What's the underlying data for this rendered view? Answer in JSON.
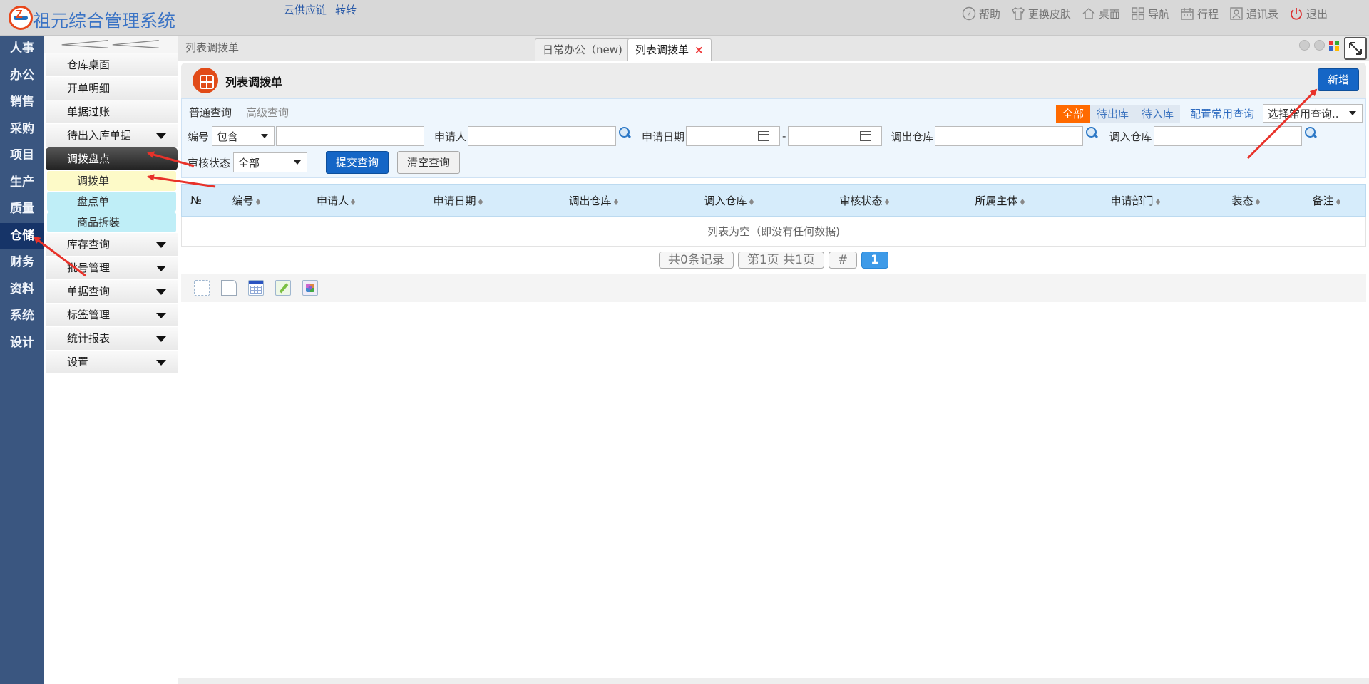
{
  "app": {
    "title": "祖元综合管理系统"
  },
  "header": {
    "links": [
      "云供应链",
      "转转"
    ],
    "actions": [
      {
        "label": "帮助",
        "icon": "help-icon"
      },
      {
        "label": "更换皮肤",
        "icon": "shirt-icon"
      },
      {
        "label": "桌面",
        "icon": "home-icon"
      },
      {
        "label": "导航",
        "icon": "nav-icon"
      },
      {
        "label": "行程",
        "icon": "calendar-icon"
      },
      {
        "label": "通讯录",
        "icon": "contacts-icon"
      },
      {
        "label": "退出",
        "icon": "power-icon"
      }
    ]
  },
  "leftnav": {
    "items": [
      "人事",
      "办公",
      "销售",
      "采购",
      "项目",
      "生产",
      "质量",
      "仓储",
      "财务",
      "资料",
      "系统",
      "设计"
    ],
    "active": "仓储"
  },
  "submenu": {
    "items": [
      {
        "label": "仓库桌面",
        "type": "item"
      },
      {
        "label": "开单明细",
        "type": "item"
      },
      {
        "label": "单据过账",
        "type": "item"
      },
      {
        "label": "待出入库单据",
        "type": "group"
      },
      {
        "label": "调拨盘点",
        "type": "current"
      },
      {
        "label": "调拨单",
        "type": "sub-selected"
      },
      {
        "label": "盘点单",
        "type": "sub"
      },
      {
        "label": "商品拆装",
        "type": "sub"
      },
      {
        "label": "库存查询",
        "type": "group"
      },
      {
        "label": "批号管理",
        "type": "group"
      },
      {
        "label": "单据查询",
        "type": "group"
      },
      {
        "label": "标签管理",
        "type": "group"
      },
      {
        "label": "统计报表",
        "type": "group"
      },
      {
        "label": "设置",
        "type": "group"
      }
    ]
  },
  "tabs": {
    "breadcrumb": "列表调拨单",
    "items": [
      {
        "label": "日常办公（new)",
        "active": false
      },
      {
        "label": "列表调拨单",
        "active": true
      }
    ],
    "close": "×"
  },
  "panel": {
    "title": "列表调拨单",
    "new_label": "新增"
  },
  "search": {
    "query_tabs": [
      "普通查询",
      "高级查询"
    ],
    "filters": [
      "全部",
      "待出库",
      "待入库"
    ],
    "config_label": "配置常用查询",
    "common_query_placeholder": "选择常用查询..",
    "fields": {
      "code_label": "编号",
      "code_op": "包含",
      "applicant_label": "申请人",
      "date_label": "申请日期",
      "date_sep": "-",
      "out_wh_label": "调出仓库",
      "in_wh_label": "调入仓库",
      "audit_label": "审核状态",
      "audit_value": "全部"
    },
    "submit_label": "提交查询",
    "clear_label": "清空查询"
  },
  "table": {
    "columns": [
      "№",
      "编号",
      "申请人",
      "申请日期",
      "调出仓库",
      "调入仓库",
      "审核状态",
      "所属主体",
      "申请部门",
      "装态",
      "备注"
    ],
    "empty_text": "列表为空（即没有任何数据)"
  },
  "pager": {
    "total": "共0条记录",
    "page": "第1页 共1页",
    "hash": "#",
    "current": "1"
  },
  "colors": {
    "accent": "#1566c6",
    "nav": "#3a5680",
    "filter_on": "#ff6a00",
    "arrow": "#e8322a"
  }
}
